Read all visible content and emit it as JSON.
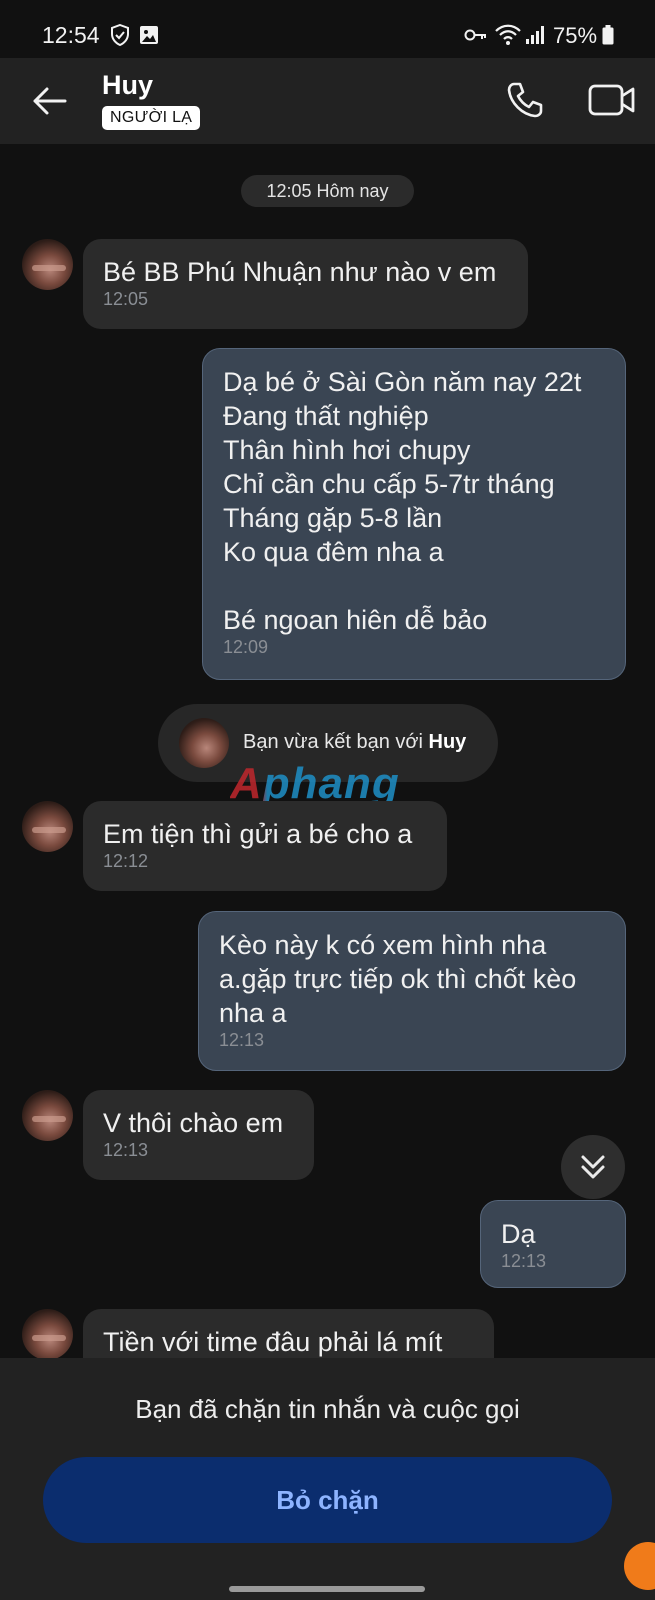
{
  "status_bar": {
    "time": "12:54",
    "battery": "75%",
    "icons": [
      "shield-icon",
      "gallery-icon",
      "key-icon",
      "wifi-icon",
      "signal-icon",
      "battery-icon"
    ]
  },
  "header": {
    "contact_name": "Huy",
    "badge": "NGƯỜI LẠ",
    "icons": [
      "back-arrow-icon",
      "phone-icon",
      "video-camera-icon"
    ]
  },
  "chat": {
    "date_separator": "12:05 Hôm nay",
    "messages": [
      {
        "direction": "incoming",
        "text": "Bé BB Phú Nhuận như nào v em",
        "time": "12:05"
      },
      {
        "direction": "outgoing",
        "text": "Dạ bé ở Sài Gòn năm nay 22t\nĐang thất nghiệp\nThân hình hơi chupy\nChỉ cần chu cấp 5-7tr tháng\nTháng gặp 5-8 lần\nKo qua đêm nha a\n\nBé ngoan hiên dễ bảo",
        "time": "12:09"
      },
      {
        "direction": "incoming",
        "text": "Em tiện thì gửi a bé cho a",
        "time": "12:12"
      },
      {
        "direction": "outgoing",
        "text": "Kèo này k có xem hình nha\na.gặp trực tiếp ok thì chốt kèo\nnha a",
        "time": "12:13"
      },
      {
        "direction": "incoming",
        "text": "V thôi chào em",
        "time": "12:13"
      },
      {
        "direction": "outgoing",
        "text": "Dạ",
        "time": "12:13"
      },
      {
        "direction": "incoming",
        "text": "Tiền với time đâu phải lá mít",
        "time": ""
      }
    ],
    "friend_notice": {
      "prefix": "Bạn vừa kết bạn với",
      "name": "Huy"
    },
    "watermark": "Aphang"
  },
  "bottom": {
    "block_notice": "Bạn đã chặn tin nhắn và cuộc gọi",
    "unblock_label": "Bỏ chặn"
  },
  "colors": {
    "background": "#111111",
    "header": "#222222",
    "incoming_bubble": "#2b2b2b",
    "outgoing_bubble": "#3a4553",
    "unblock_button": "#0b2d6e",
    "unblock_text": "#8eb4ff"
  }
}
